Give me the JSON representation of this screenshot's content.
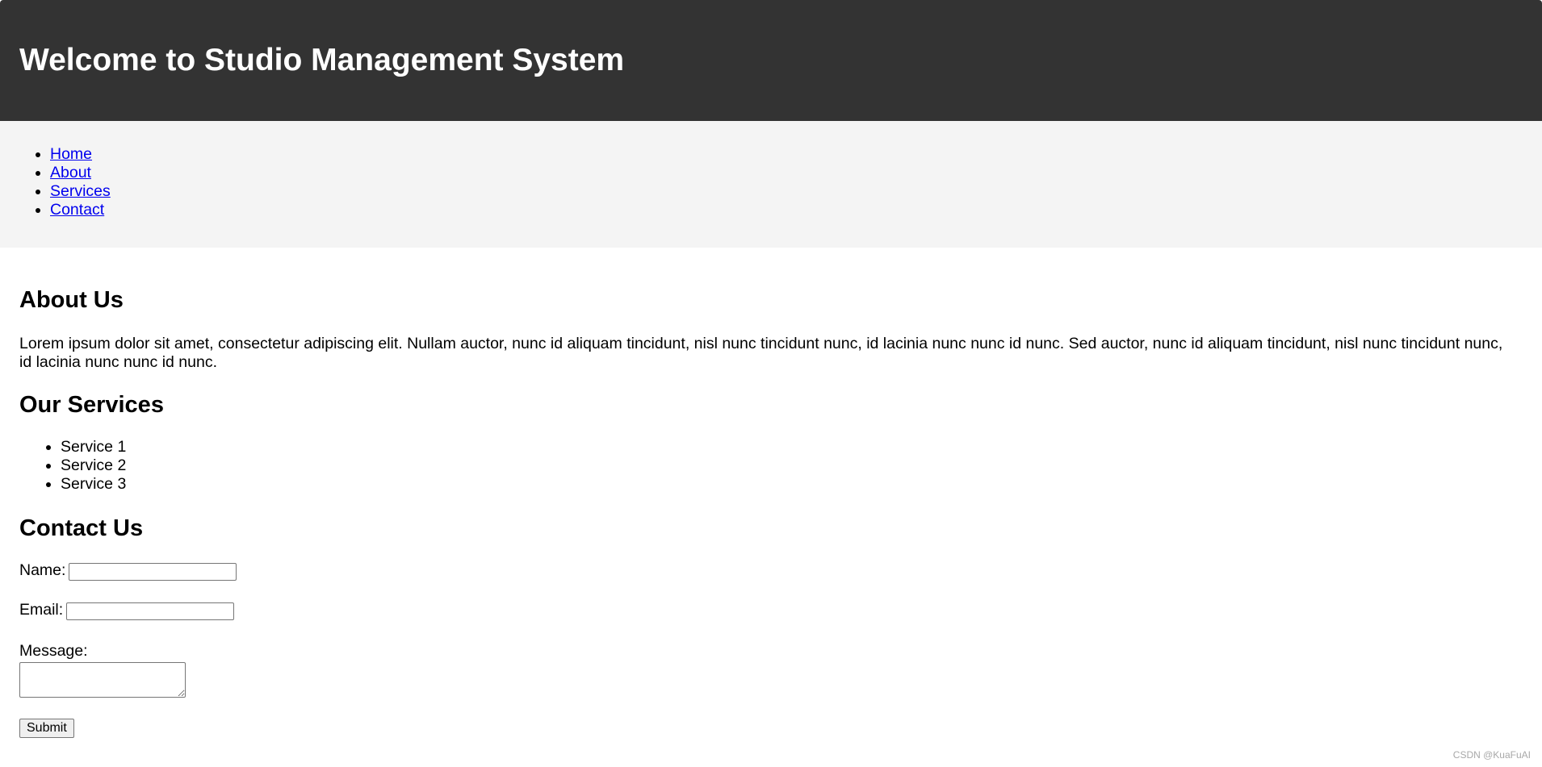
{
  "header": {
    "title": "Welcome to Studio Management System"
  },
  "nav": {
    "items": [
      {
        "label": "Home"
      },
      {
        "label": "About"
      },
      {
        "label": "Services"
      },
      {
        "label": "Contact"
      }
    ]
  },
  "about": {
    "title": "About Us",
    "text": "Lorem ipsum dolor sit amet, consectetur adipiscing elit. Nullam auctor, nunc id aliquam tincidunt, nisl nunc tincidunt nunc, id lacinia nunc nunc id nunc. Sed auctor, nunc id aliquam tincidunt, nisl nunc tincidunt nunc, id lacinia nunc nunc id nunc."
  },
  "services": {
    "title": "Our Services",
    "items": [
      {
        "label": "Service 1"
      },
      {
        "label": "Service 2"
      },
      {
        "label": "Service 3"
      }
    ]
  },
  "contact": {
    "title": "Contact Us",
    "name_label": "Name:",
    "email_label": "Email:",
    "message_label": "Message:",
    "name_value": "",
    "email_value": "",
    "message_value": "",
    "submit_label": "Submit"
  },
  "watermark": "CSDN @KuaFuAI",
  "colors": {
    "header_bg": "#333333",
    "nav_bg": "#f4f4f4",
    "link": "#0000ee"
  }
}
